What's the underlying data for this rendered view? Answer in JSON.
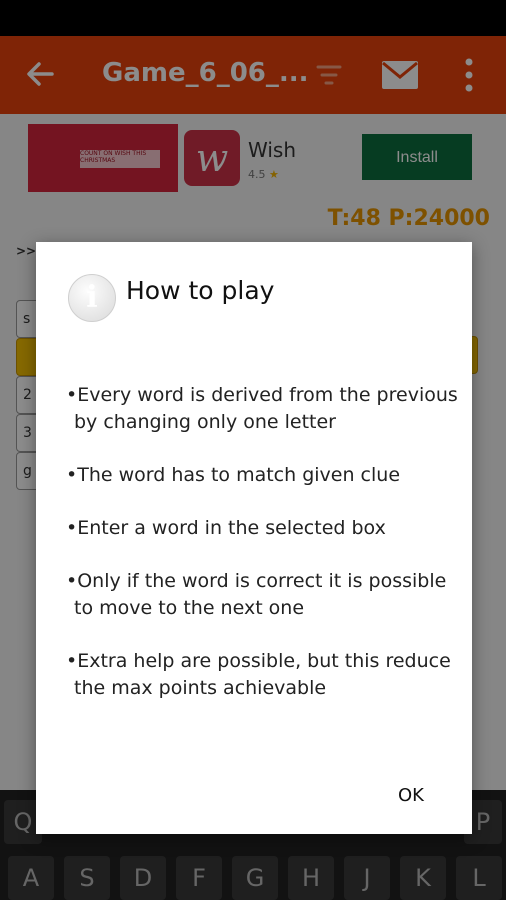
{
  "appbar": {
    "title": "Game_6_06_...",
    "back_icon": "arrow-left-icon",
    "filter_icon": "filter-icon",
    "mail_icon": "mail-icon",
    "more_icon": "more-vert-icon",
    "color": "#e8420c"
  },
  "ad": {
    "app_name": "Wish",
    "rating": "4.5",
    "install_label": "Install",
    "banner_text": "COUNT ON WISH THIS CHRISTMAS"
  },
  "game": {
    "score": "T:48 P:24000",
    "arrows": ">>",
    "boxes": [
      "s",
      "",
      "2",
      "3",
      "g"
    ]
  },
  "dialog": {
    "title": "How to play",
    "rules": [
      "•Every word is derived from the previous by changing only one letter",
      "•The word has to match given clue",
      "•Enter a word in the selected box",
      "•Only if the word is correct it is possible to move to the next one",
      "•Extra help are possible, but this reduce the max points achievable"
    ],
    "ok_label": "OK"
  },
  "keyboard": {
    "row1": [
      "Q",
      "P"
    ],
    "row2": [
      "A",
      "S",
      "D",
      "F",
      "G",
      "H",
      "J",
      "K",
      "L"
    ]
  }
}
